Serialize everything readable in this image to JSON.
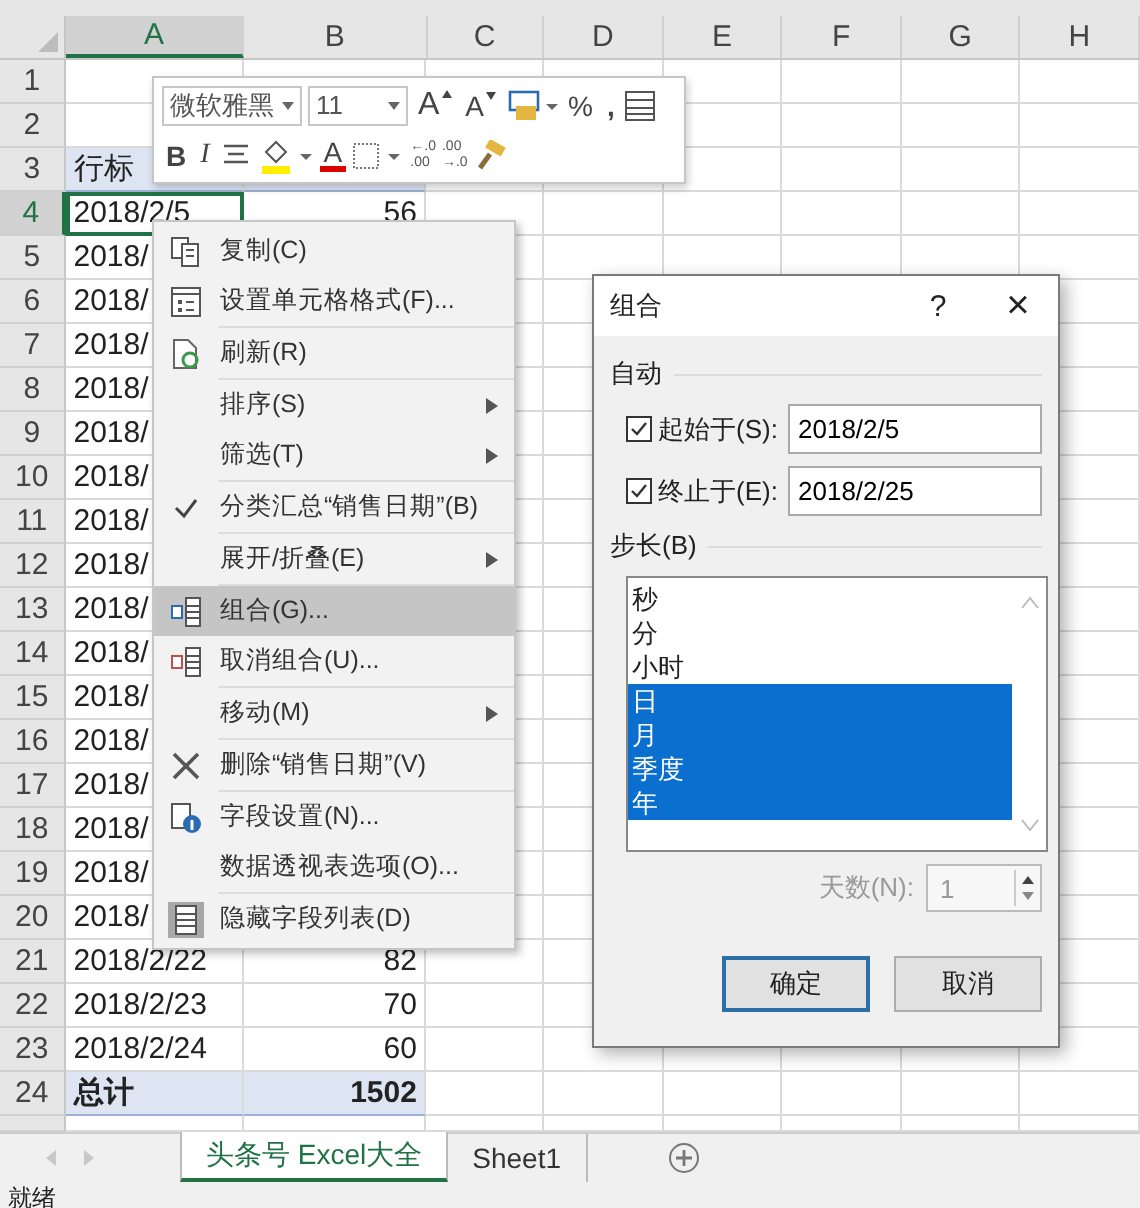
{
  "columns": [
    {
      "label": "A",
      "selected": true
    },
    {
      "label": "B",
      "selected": false
    },
    {
      "label": "C",
      "selected": false
    },
    {
      "label": "D",
      "selected": false
    },
    {
      "label": "E",
      "selected": false
    },
    {
      "label": "F",
      "selected": false
    },
    {
      "label": "G",
      "selected": false
    },
    {
      "label": "H",
      "selected": false
    }
  ],
  "rows": [
    {
      "number": "1",
      "kind": "blank",
      "selected": false
    },
    {
      "number": "2",
      "kind": "blank",
      "selected": false
    },
    {
      "number": "3",
      "kind": "header",
      "label": "行标",
      "selected": false
    },
    {
      "number": "4",
      "kind": "data",
      "label": "2018/2/5",
      "value": "56",
      "selected": true
    },
    {
      "number": "5",
      "kind": "data",
      "label": "2018/",
      "selected": false
    },
    {
      "number": "6",
      "kind": "data",
      "label": "2018/",
      "selected": false
    },
    {
      "number": "7",
      "kind": "data",
      "label": "2018/",
      "selected": false
    },
    {
      "number": "8",
      "kind": "data",
      "label": "2018/",
      "selected": false
    },
    {
      "number": "9",
      "kind": "data",
      "label": "2018/",
      "selected": false
    },
    {
      "number": "10",
      "kind": "data",
      "label": "2018/",
      "selected": false
    },
    {
      "number": "11",
      "kind": "data",
      "label": "2018/",
      "selected": false
    },
    {
      "number": "12",
      "kind": "data",
      "label": "2018/",
      "selected": false
    },
    {
      "number": "13",
      "kind": "data",
      "label": "2018/",
      "selected": false
    },
    {
      "number": "14",
      "kind": "data",
      "label": "2018/",
      "selected": false
    },
    {
      "number": "15",
      "kind": "data",
      "label": "2018/",
      "selected": false
    },
    {
      "number": "16",
      "kind": "data",
      "label": "2018/",
      "selected": false
    },
    {
      "number": "17",
      "kind": "data",
      "label": "2018/",
      "selected": false
    },
    {
      "number": "18",
      "kind": "data",
      "label": "2018/",
      "selected": false
    },
    {
      "number": "19",
      "kind": "data",
      "label": "2018/",
      "selected": false
    },
    {
      "number": "20",
      "kind": "data",
      "label": "2018/",
      "selected": false
    },
    {
      "number": "21",
      "kind": "data",
      "label": "2018/2/22",
      "value": "82",
      "selected": false
    },
    {
      "number": "22",
      "kind": "data",
      "label": "2018/2/23",
      "value": "70",
      "selected": false
    },
    {
      "number": "23",
      "kind": "data",
      "label": "2018/2/24",
      "value": "60",
      "selected": false
    },
    {
      "number": "24",
      "kind": "total",
      "label": "总计",
      "value": "1502",
      "selected": false
    }
  ],
  "mini_toolbar": {
    "font_name": "微软雅黑",
    "font_size": "11",
    "grow_font": "A",
    "shrink_font": "A",
    "percent": "%",
    "comma": ",",
    "bold": "B",
    "italic": "I",
    "font_color": "A",
    "increase_decimal": [
      "←.0",
      ".00"
    ],
    "decrease_decimal": [
      ".00",
      "→.0"
    ]
  },
  "context_menu": [
    {
      "label": "复制(C)",
      "kind": "copy",
      "submenu": false,
      "checked": false,
      "selected": false,
      "divider_above": false
    },
    {
      "label": "设置单元格格式(F)...",
      "kind": "format",
      "submenu": false,
      "checked": false,
      "selected": false,
      "divider_above": false
    },
    {
      "label": "刷新(R)",
      "kind": "refresh",
      "submenu": false,
      "checked": false,
      "selected": false,
      "divider_above": true
    },
    {
      "label": "排序(S)",
      "submenu": true,
      "checked": false,
      "selected": false,
      "divider_above": true
    },
    {
      "label": "筛选(T)",
      "submenu": true,
      "checked": false,
      "selected": false,
      "divider_above": false
    },
    {
      "label": "分类汇总“销售日期”(B)",
      "submenu": false,
      "checked": true,
      "selected": false,
      "divider_above": true
    },
    {
      "label": "展开/折叠(E)",
      "submenu": true,
      "checked": false,
      "selected": false,
      "divider_above": true
    },
    {
      "label": "组合(G)...",
      "kind": "group",
      "submenu": false,
      "checked": false,
      "selected": true,
      "divider_above": true
    },
    {
      "label": "取消组合(U)...",
      "kind": "ungroup",
      "submenu": false,
      "checked": false,
      "selected": false,
      "divider_above": false
    },
    {
      "label": "移动(M)",
      "submenu": true,
      "checked": false,
      "selected": false,
      "divider_above": true
    },
    {
      "label": "删除“销售日期”(V)",
      "kind": "delete",
      "submenu": false,
      "checked": false,
      "selected": false,
      "divider_above": true
    },
    {
      "label": "字段设置(N)...",
      "kind": "field_settings",
      "submenu": false,
      "checked": false,
      "selected": false,
      "divider_above": true
    },
    {
      "label": "数据透视表选项(O)...",
      "submenu": false,
      "checked": false,
      "selected": false,
      "divider_above": false
    },
    {
      "label": "隐藏字段列表(D)",
      "kind": "field_list",
      "submenu": false,
      "checked": false,
      "selected": false,
      "divider_above": true
    }
  ],
  "dialog": {
    "title": "组合",
    "help": "?",
    "close": "×",
    "auto_label": "自动",
    "start": {
      "label": "起始于(S):",
      "checked": true,
      "value": "2018/2/5"
    },
    "end": {
      "label": "终止于(E):",
      "checked": true,
      "value": "2018/2/25"
    },
    "step_label": "步长(B)",
    "step_items": [
      {
        "label": "秒",
        "selected": false
      },
      {
        "label": "分",
        "selected": false
      },
      {
        "label": "小时",
        "selected": false
      },
      {
        "label": "日",
        "selected": true
      },
      {
        "label": "月",
        "selected": true
      },
      {
        "label": "季度",
        "selected": true
      },
      {
        "label": "年",
        "selected": true
      }
    ],
    "days": {
      "label": "天数(N):",
      "value": "1",
      "disabled": true
    },
    "buttons": [
      {
        "label": "确定",
        "default": true
      },
      {
        "label": "取消",
        "default": false
      }
    ]
  },
  "sheet_tabs": [
    {
      "label": "头条号 Excel大全",
      "selected": true
    },
    {
      "label": "Sheet1",
      "selected": false
    }
  ],
  "status_bar": "就绪"
}
